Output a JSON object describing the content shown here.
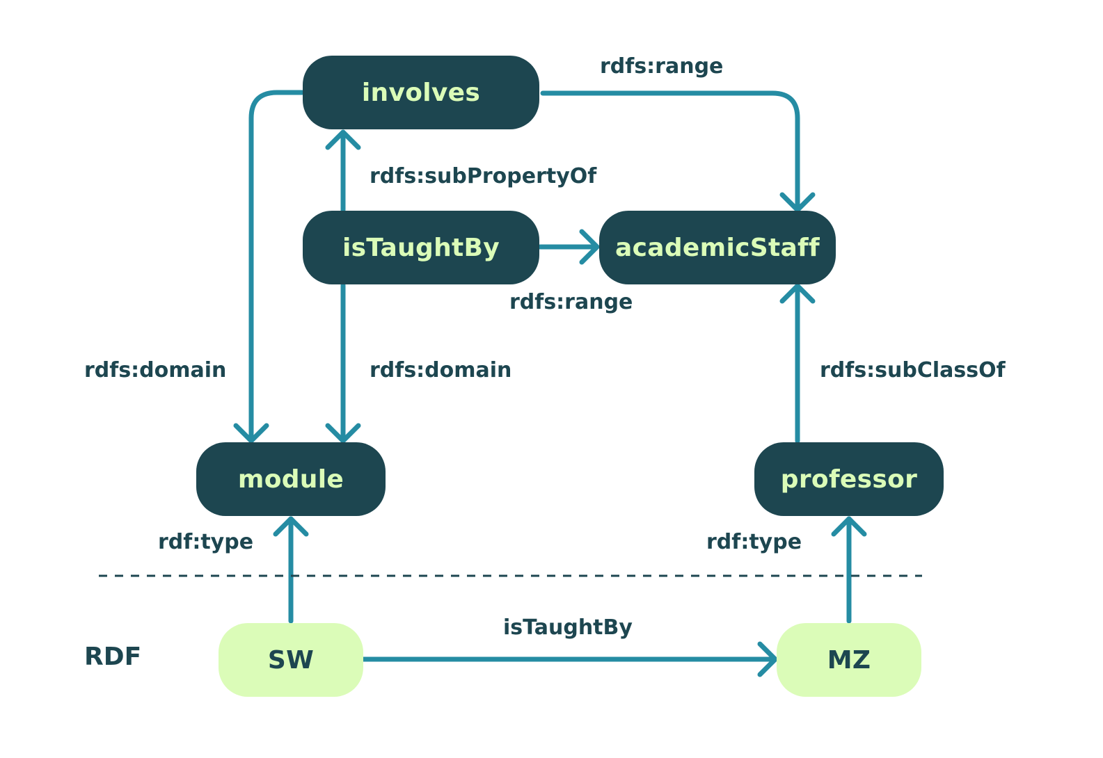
{
  "colors": {
    "schema_bg": "#1d4650",
    "schema_text": "#dbfcb8",
    "instance_bg": "#dbfcb8",
    "instance_text": "#1d4650",
    "edge": "#258ca3",
    "divider": "#1d4650"
  },
  "nodes": {
    "involves": "involves",
    "isTaughtBy": "isTaughtBy",
    "academicStaff": "academicStaff",
    "module": "module",
    "professor": "professor",
    "SW": "SW",
    "MZ": "MZ"
  },
  "edges": [
    {
      "from": "involves",
      "to": "academicStaff",
      "label": "rdfs:range"
    },
    {
      "from": "involves",
      "to": "module",
      "label": "rdfs:domain"
    },
    {
      "from": "isTaughtBy",
      "to": "involves",
      "label": "rdfs:subPropertyOf"
    },
    {
      "from": "isTaughtBy",
      "to": "academicStaff",
      "label": "rdfs:range"
    },
    {
      "from": "isTaughtBy",
      "to": "module",
      "label": "rdfs:domain"
    },
    {
      "from": "professor",
      "to": "academicStaff",
      "label": "rdfs:subClassOf"
    },
    {
      "from": "SW",
      "to": "module",
      "label": "rdf:type"
    },
    {
      "from": "MZ",
      "to": "professor",
      "label": "rdf:type"
    },
    {
      "from": "SW",
      "to": "MZ",
      "label": "isTaughtBy"
    }
  ],
  "layer_label": "RDF"
}
